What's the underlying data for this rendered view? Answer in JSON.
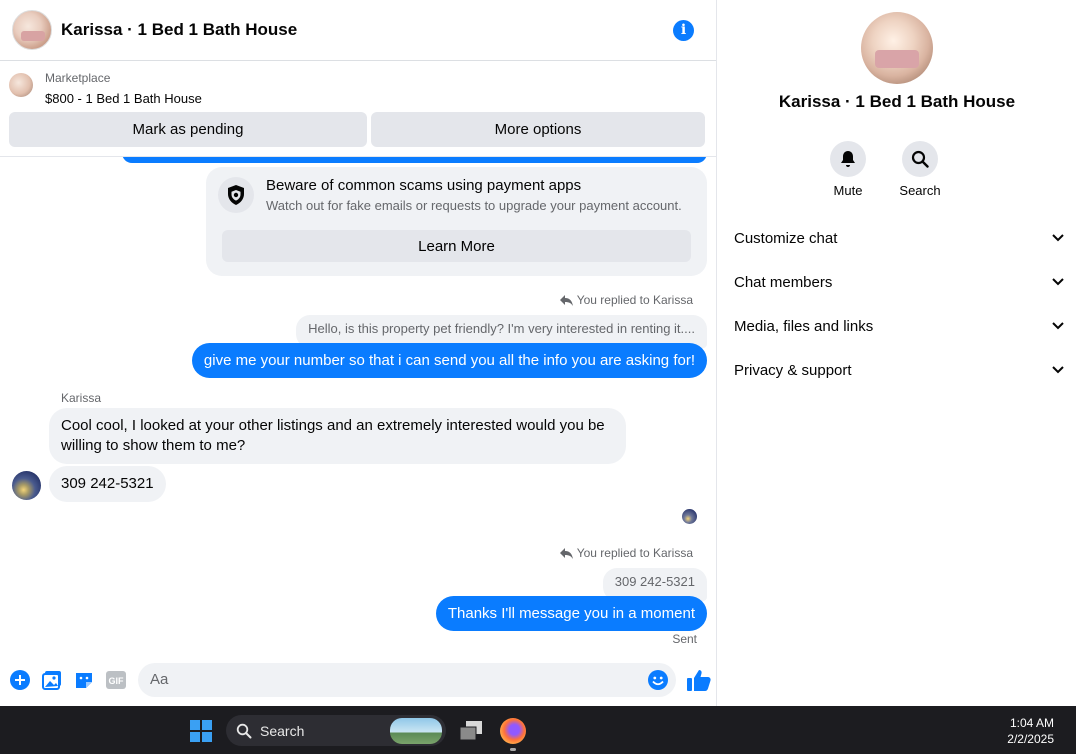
{
  "chat": {
    "title": "Karissa · 1 Bed 1 Bath House",
    "listing": {
      "source": "Marketplace",
      "title": "$800 - 1 Bed 1 Bath House",
      "mark_pending": "Mark as pending",
      "more_options": "More options"
    },
    "scam_notice": {
      "title": "Beware of common scams using payment apps",
      "subtitle": "Watch out for fake emails or requests to upgrade your payment account.",
      "button": "Learn More"
    },
    "messages": {
      "replied_label_1": "You replied to Karissa",
      "quoted_1": "Hello, is this property pet friendly? I'm very interested in renting it....",
      "out_1": "give me your number so that i can send you all the info you are asking for!",
      "sender_name": "Karissa",
      "in_1": "Cool cool, I looked at your other listings and an extremely interested would you be willing to show them to me?",
      "in_2": "309 242-5321",
      "replied_label_2": "You replied to Karissa",
      "quoted_2": "309 242-5321",
      "out_2": "Thanks I'll message you in a moment",
      "status": "Sent"
    },
    "composer": {
      "placeholder": "Aa",
      "gif_label": "GIF"
    }
  },
  "info_panel": {
    "title": "Karissa · 1 Bed 1 Bath House",
    "actions": [
      {
        "label": "Mute",
        "icon": "bell-icon"
      },
      {
        "label": "Search",
        "icon": "search-icon"
      }
    ],
    "sections": [
      {
        "label": "Customize chat"
      },
      {
        "label": "Chat members"
      },
      {
        "label": "Media, files and links"
      },
      {
        "label": "Privacy & support"
      }
    ]
  },
  "taskbar": {
    "search_label": "Search",
    "time": "1:04 AM",
    "date": "2/2/2025"
  },
  "colors": {
    "accent": "#0a7cff",
    "bubble_in": "#f0f2f5",
    "button_bg": "#e4e6eb",
    "taskbar": "#1c1c20"
  }
}
